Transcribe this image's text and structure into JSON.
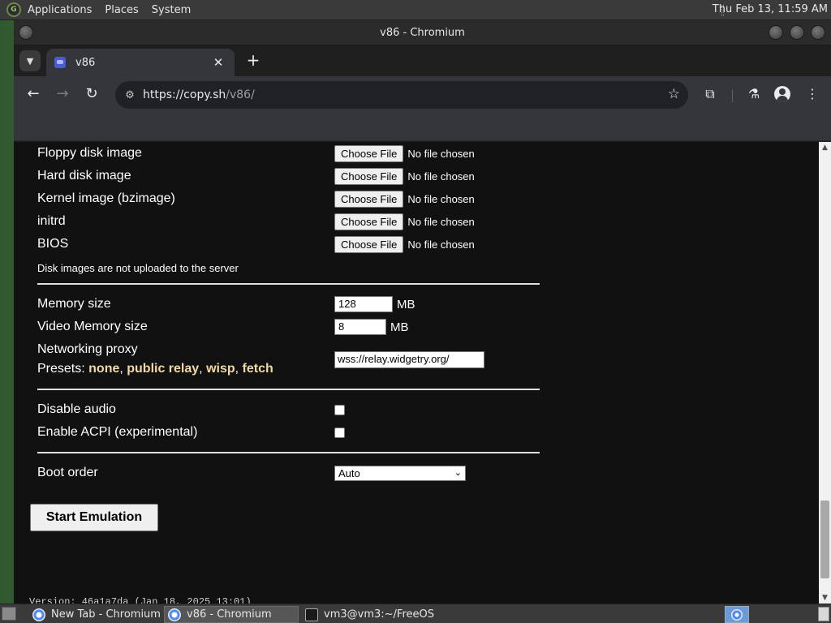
{
  "top_panel": {
    "menus": [
      "Applications",
      "Places",
      "System"
    ],
    "clock": "Thu Feb 13, 11:59 AM"
  },
  "window": {
    "title": "v86 - Chromium"
  },
  "browser": {
    "tab": {
      "title": "v86",
      "close": "✕"
    },
    "new_tab": "+",
    "url_host": "https://copy.sh",
    "url_path": "/v86/"
  },
  "page": {
    "file_rows": [
      {
        "label": "Floppy disk image",
        "button": "Choose File",
        "status": "No file chosen"
      },
      {
        "label": "Hard disk image",
        "button": "Choose File",
        "status": "No file chosen"
      },
      {
        "label": "Kernel image (bzimage)",
        "button": "Choose File",
        "status": "No file chosen"
      },
      {
        "label": "initrd",
        "button": "Choose File",
        "status": "No file chosen"
      },
      {
        "label": "BIOS",
        "button": "Choose File",
        "status": "No file chosen"
      }
    ],
    "disk_note": "Disk images are not uploaded to the server",
    "memory": {
      "label": "Memory size",
      "value": "128",
      "unit": "MB"
    },
    "video_memory": {
      "label": "Video Memory size",
      "value": "8",
      "unit": "MB"
    },
    "networking": {
      "label": "Networking proxy",
      "presets_label": "Presets:",
      "presets": [
        "none",
        "public relay",
        "wisp",
        "fetch"
      ],
      "value": "wss://relay.widgetry.org/"
    },
    "disable_audio": {
      "label": "Disable audio",
      "checked": false
    },
    "enable_acpi": {
      "label": "Enable ACPI (experimental)",
      "checked": false
    },
    "boot_order": {
      "label": "Boot order",
      "selected": "Auto"
    },
    "start_button": "Start Emulation",
    "version": "Version: 46a1a7da (Jan 18, 2025 13:01)"
  },
  "taskbar": {
    "items": [
      {
        "label": "New Tab - Chromium",
        "active": false
      },
      {
        "label": "v86 - Chromium",
        "active": true
      },
      {
        "label": "vm3@vm3:~/FreeOS",
        "active": false
      }
    ]
  }
}
